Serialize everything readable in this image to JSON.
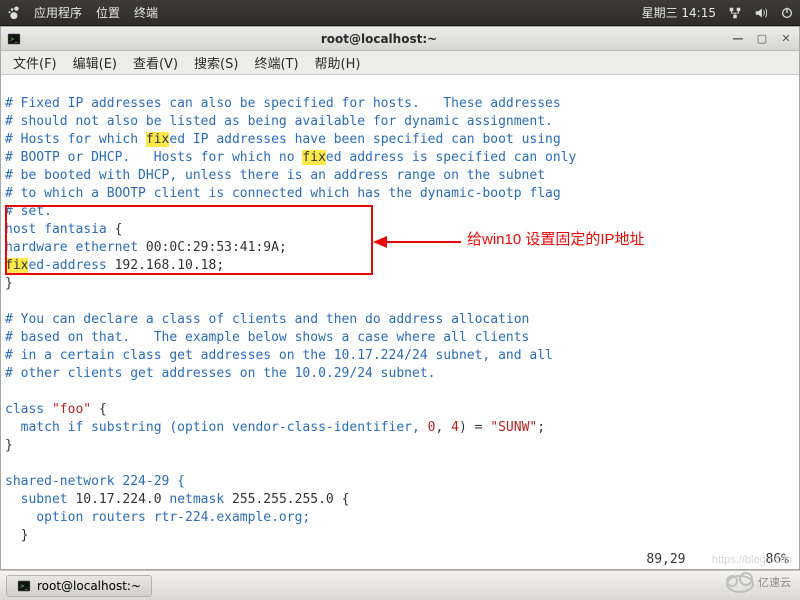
{
  "panel": {
    "menu_apps": "应用程序",
    "menu_places": "位置",
    "menu_terminal": "终端",
    "clock": "星期三 14:15"
  },
  "window": {
    "title": "root@localhost:~"
  },
  "menubar": {
    "file": "文件(F)",
    "edit": "编辑(E)",
    "view": "查看(V)",
    "search": "搜索(S)",
    "terminal": "终端(T)",
    "help": "帮助(H)"
  },
  "content": {
    "c1": "# Fixed IP addresses can also be specified for hosts.   These addresses",
    "c2": "# should not also be listed as being available for dynamic assignment.",
    "c3a": "# Hosts for which ",
    "fix1": "fix",
    "c3b": "ed IP addresses have been specified can boot using",
    "c4a": "# BOOTP or DHCP.   Hosts for which no ",
    "fix2": "fix",
    "c4b": "ed address is specified can only",
    "c5": "# be booted with DHCP, unless there is an address range on the subnet",
    "c6": "# to which a BOOTP client is connected which has the dynamic-bootp flag",
    "c7": "# set.",
    "l8a": "host fantasia ",
    "l8b": "{",
    "l9a": "hardware ethernet ",
    "l9b": "00:0C:29:53:41:9A",
    "l10a": "fix",
    "l10b": "ed-address ",
    "l10c": "192.168.10.18",
    "l11": "}",
    "c12": "# You can declare a class of clients and then do address allocation",
    "c13": "# based on that.   The example below shows a case where all clients",
    "c14": "# in a certain class get addresses on the 10.17.224/24 subnet, and all",
    "c15": "# other clients get addresses on the 10.0.29/24 subnet.",
    "l16a": "class ",
    "l16b": "\"foo\"",
    "l16c": " {",
    "l17a": "  match if substring (option vendor-class-identifier, ",
    "l17b": "0",
    "l17c": ", ",
    "l17d": "4",
    "l17e": ") = ",
    "l17f": "\"SUNW\"",
    "l17g": ";",
    "l18": "}",
    "l19": "shared-network 224-29 {",
    "l20a": "  subnet ",
    "l20b": "10.17.224.0",
    "l20c": " netmask ",
    "l20d": "255.255.255.0",
    "l20e": " {",
    "l21": "    option routers rtr-224.example.org;",
    "l22": "  }"
  },
  "annotation": {
    "text": "给win10 设置固定的IP地址"
  },
  "status": {
    "pos": "89,29",
    "pct": "86%"
  },
  "taskbar": {
    "item": "root@localhost:~"
  },
  "watermark": "https://blog.csdn",
  "logo": "亿速云"
}
